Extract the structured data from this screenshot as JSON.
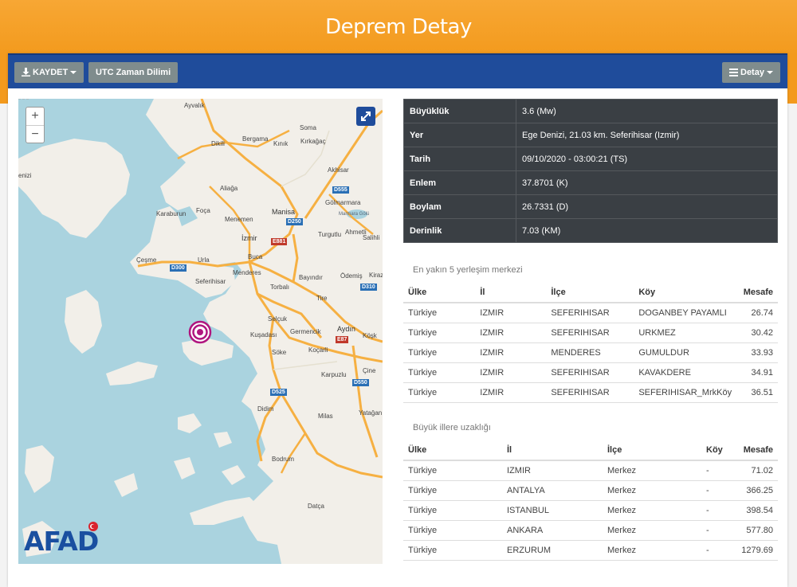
{
  "page": {
    "title": "Deprem Detay"
  },
  "toolbar": {
    "save_label": "KAYDET",
    "utc_label": "UTC Zaman Dilimi",
    "detail_label": "Detay"
  },
  "map": {
    "zoom_in": "+",
    "zoom_out": "−",
    "logo": "AFAD",
    "labels": {
      "ayvalik": "Ayvalık",
      "dikili": "Dikili",
      "bergama": "Bergama",
      "kinik": "Kınık",
      "soma": "Soma",
      "kirkagac": "Kırkağaç",
      "akhisar": "Akhisar",
      "aliaga": "Aliağa",
      "karaburun": "Karaburun",
      "foca": "Foça",
      "menemen": "Menemen",
      "manisa": "Manisa",
      "golmarmara": "Gölmarmara",
      "marmara_golu": "Marmara Gölü",
      "turgutlu": "Turgutlu",
      "ahmetli": "Ahmetli",
      "salihli": "Salihli",
      "izmir": "İzmir",
      "buca": "Buca",
      "cesme": "Çeşme",
      "urla": "Urla",
      "seferihisar": "Seferihisar",
      "menderes": "Menderes",
      "torbali": "Torbalı",
      "bayindir": "Bayındır",
      "odemis": "Ödemiş",
      "kiraz": "Kiraz",
      "tire": "Tire",
      "selcuk": "Selçuk",
      "kusadasi": "Kuşadası",
      "germencik": "Germencik",
      "aydin": "Aydın",
      "soke": "Söke",
      "kocarli": "Koçarli",
      "kosk": "Köşk",
      "karpuzlu": "Karpuzlu",
      "cine": "Çine",
      "didim": "Didim",
      "milas": "Milas",
      "yatagan": "Yatağan",
      "bodrum": "Bodrum",
      "datca": "Datça",
      "denizi": "enizi"
    },
    "roads": {
      "d555": "D555",
      "d250": "D250",
      "e881": "E881",
      "d300": "D300",
      "d310": "D310",
      "e87": "E87",
      "d525": "D525",
      "d550": "D550"
    }
  },
  "details": [
    {
      "key": "Büyüklük",
      "value": "3.6 (Mw)"
    },
    {
      "key": "Yer",
      "value": "Ege Denizi, 21.03 km. Seferihisar (Izmir)"
    },
    {
      "key": "Tarih",
      "value": "09/10/2020 - 03:00:21 (TS)"
    },
    {
      "key": "Enlem",
      "value": "37.8701 (K)"
    },
    {
      "key": "Boylam",
      "value": "26.7331 (D)"
    },
    {
      "key": "Derinlik",
      "value": "7.03 (KM)"
    }
  ],
  "nearest": {
    "title": "En yakın 5 yerleşim merkezi",
    "headers": [
      "Ülke",
      "İl",
      "İlçe",
      "Köy",
      "Mesafe"
    ],
    "rows": [
      [
        "Türkiye",
        "IZMIR",
        "SEFERIHISAR",
        "DOGANBEY PAYAMLI",
        "26.74"
      ],
      [
        "Türkiye",
        "IZMIR",
        "SEFERIHISAR",
        "URKMEZ",
        "30.42"
      ],
      [
        "Türkiye",
        "IZMIR",
        "MENDERES",
        "GUMULDUR",
        "33.93"
      ],
      [
        "Türkiye",
        "IZMIR",
        "SEFERIHISAR",
        "KAVAKDERE",
        "34.91"
      ],
      [
        "Türkiye",
        "IZMIR",
        "SEFERIHISAR",
        "SEFERIHISAR_MrkKöy",
        "36.51"
      ]
    ]
  },
  "cities": {
    "title": "Büyük illere uzaklığı",
    "headers": [
      "Ülke",
      "İl",
      "İlçe",
      "Köy",
      "Mesafe"
    ],
    "rows": [
      [
        "Türkiye",
        "IZMIR",
        "Merkez",
        "-",
        "71.02"
      ],
      [
        "Türkiye",
        "ANTALYA",
        "Merkez",
        "-",
        "366.25"
      ],
      [
        "Türkiye",
        "ISTANBUL",
        "Merkez",
        "-",
        "398.54"
      ],
      [
        "Türkiye",
        "ANKARA",
        "Merkez",
        "-",
        "577.80"
      ],
      [
        "Türkiye",
        "ERZURUM",
        "Merkez",
        "-",
        "1279.69"
      ]
    ]
  },
  "colors": {
    "header": "#f39a1d",
    "toolbar": "#1f4c9b",
    "table_dark": "#3a3f44",
    "quake_marker": "#b0157f",
    "sea": "#aad3df",
    "land": "#f2efe9"
  }
}
